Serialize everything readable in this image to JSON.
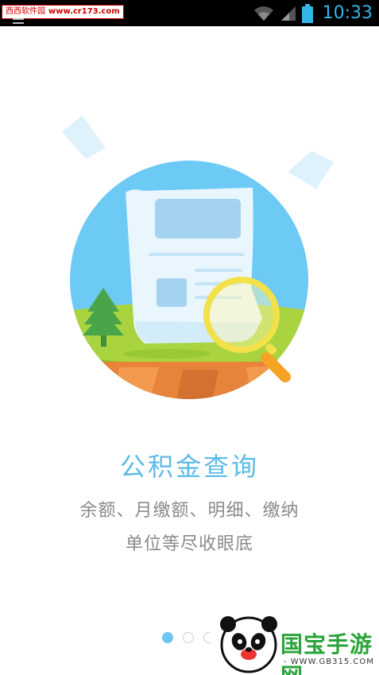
{
  "status_bar": {
    "time": "10:33",
    "watermark_site": "西西软件园",
    "watermark_url": "www.cr173.com",
    "icons": [
      "menu-icon",
      "wifi-icon",
      "signal-icon",
      "battery-icon"
    ]
  },
  "slide": {
    "title": "公积金查询",
    "description_line1": "余额、月缴额、明细、缴纳",
    "description_line2": "单位等尽收眼底"
  },
  "pager": {
    "total": 3,
    "active_index": 0
  },
  "watermark_bottom": {
    "brand": "国宝手游网",
    "url": "- WWW.GB315.COM -"
  },
  "colors": {
    "accent": "#5bbbe6",
    "sky": "#6ccaf5",
    "grass": "#9fd03a",
    "soil": "#e8833a",
    "magnifier": "#f7e84a"
  }
}
